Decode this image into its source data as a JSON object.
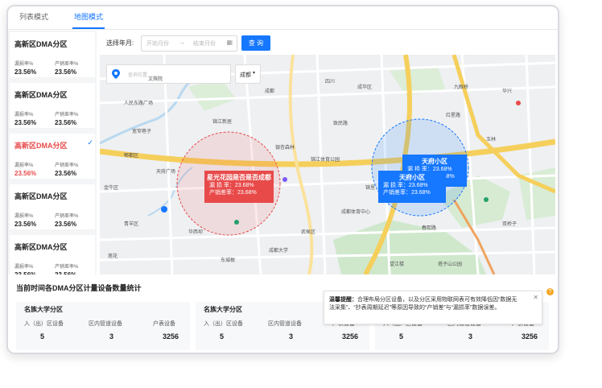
{
  "tabs": [
    {
      "label": "列表模式"
    },
    {
      "label": "地图模式"
    }
  ],
  "sidebar": {
    "items": [
      {
        "title": "高新区DMA分区",
        "leak_label": "漏损率%",
        "sales_label": "产销差率%",
        "leak": "23.56%",
        "sales": "23.56%",
        "selected": false
      },
      {
        "title": "高新区DMA分区",
        "leak_label": "漏损率%",
        "sales_label": "产销差率%",
        "leak": "23.56%",
        "sales": "23.56%",
        "selected": false
      },
      {
        "title": "高新区DMA分区",
        "leak_label": "漏损率%",
        "sales_label": "产销差率%",
        "leak": "23.56%",
        "sales": "23.56%",
        "selected": true
      },
      {
        "title": "高新区DMA分区",
        "leak_label": "漏损率%",
        "sales_label": "产销差率%",
        "leak": "23.56%",
        "sales": "23.56%",
        "selected": false
      },
      {
        "title": "高新区DMA分区",
        "leak_label": "漏损率%",
        "sales_label": "产销差率%",
        "leak": "23.56%",
        "sales": "23.56%",
        "selected": false
      }
    ]
  },
  "filter": {
    "label": "选择年月:",
    "start_placeholder": "开始月份",
    "end_placeholder": "结束月份",
    "query_button": "查 询"
  },
  "map": {
    "search_placeholder": "查询位置",
    "city": "成都",
    "popups": [
      {
        "title": "星光花园是否是否成都",
        "leak": "漏 损 率：23.68%",
        "sales": "产销差率：23.68%",
        "color": "#e84a4a"
      },
      {
        "title": "天府小区",
        "leak": "漏 损 率：23.68%",
        "sales": "产销差率：23.68%",
        "color": "#1677ff"
      },
      {
        "title": "天府小区",
        "leak": "漏 损 率：23.68%",
        "sales": "产销差率：23.68%",
        "color": "#1677ff"
      }
    ],
    "labels": {
      "pidu": "郫都区",
      "jinjiang_stadium": "锦江体育公园",
      "jinjiang_new": "锦江新居",
      "people_square": "人民东路广场",
      "chengdu_ed_u": "成都大学",
      "yinxing": "银杏森林",
      "tianfu": "天府广场",
      "jinniu": "金牛区",
      "wuhou": "武侯区",
      "chenghua": "成华区",
      "chengdu": "成都",
      "sichuan": "四川",
      "huaxi": "华西坝",
      "sports": "成都体育中心",
      "dongcheng": "东城根",
      "hongxing": "红星路",
      "yulin": "玉林",
      "shuangqiao": "双桥子",
      "tazishan": "塔子山公园",
      "wangjiang": "望江楼",
      "jiuyanqiao": "九眼桥",
      "zhimin": "致民路",
      "huaxing": "华兴",
      "lianhua": "莲花",
      "kuanzhai": "宽窄巷子",
      "wenshu": "文殊院",
      "qingyang": "青羊区",
      "jinli": "锦里",
      "chunxi": "春熙路"
    }
  },
  "stats": {
    "heading": "当前时间各DMA分区计量设备数量统计",
    "cards": [
      {
        "name": "名族大学分区",
        "c1": "入（出）区设备",
        "c2": "区内管道设备",
        "c3": "户表设备",
        "n1": "5",
        "n2": "3",
        "n3": "3256"
      },
      {
        "name": "名族大学分区",
        "c1": "入（出）区设备",
        "c2": "区内管道设备",
        "c3": "户表设备",
        "n1": "5",
        "n2": "3",
        "n3": "3256"
      },
      {
        "name": "",
        "c1": "入（出）区设备",
        "c2": "区内管道设备",
        "c3": "户表设备",
        "n1": "5",
        "n2": "3",
        "n3": "3256"
      }
    ],
    "tip_title": "温馨提醒：",
    "tip_text": "合理布局分区设备，以及分区采用物联网表可有效降低因“数据无法采集”、“抄表周期延迟”等原因导致的“产销差”与“漏损率”数据误差。"
  }
}
